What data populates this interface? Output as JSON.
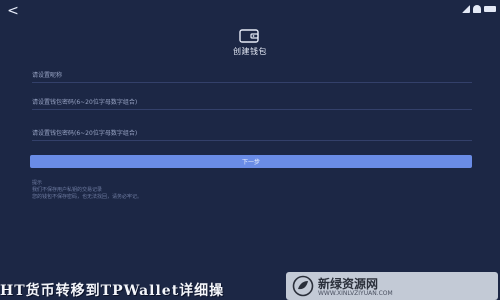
{
  "header": {
    "back_glyph": "<",
    "title": "创建钱包"
  },
  "form": {
    "nickname_placeholder": "请设置昵称",
    "password_placeholder": "请设置钱包密码(6~20位字母数字组合)",
    "confirm_placeholder": "请设置钱包密码(6~20位字母数字组合)",
    "next_label": "下一步"
  },
  "notice": {
    "title": "提示",
    "line1": "我们不保存用户私钥的交易记录",
    "line2": "您的钱包不保存密码，也无法找回，请务必牢记。"
  },
  "watermark": {
    "text": "HT货币转移到TPWallet详细操",
    "badge_title": "新绿资源网",
    "badge_url": "WWW.XINLVZIYUAN.COM"
  },
  "colors": {
    "background": "#1c2745",
    "accent": "#6a8ce6",
    "divider": "#33406a"
  },
  "icons": {
    "back": "chevron-left-icon",
    "wallet": "wallet-icon",
    "status": [
      "signal-icon",
      "wifi-icon",
      "battery-icon"
    ],
    "badge_logo": "leaf-logo-icon"
  }
}
